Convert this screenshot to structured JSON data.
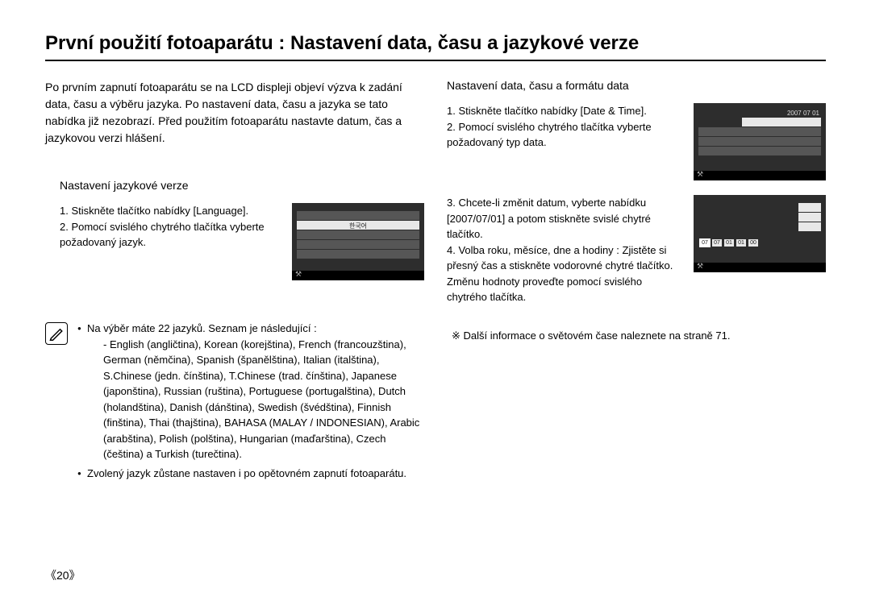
{
  "title": "První použití fotoaparátu : Nastavení data, času a jazykové verze",
  "intro": "Po prvním zapnutí fotoaparátu se na LCD displeji objeví výzva k zadání data, času a výběru jazyka. Po nastavení data, času a jazyka se tato nabídka již nezobrazí. Před použitím fotoaparátu nastavte datum, čas a jazykovou verzi hlášení.",
  "left": {
    "subhead": "Nastavení jazykové verze",
    "step1": "1. Stiskněte tlačítko nabídky [Language].",
    "step2": "2. Pomocí svislého chytrého tlačítka vyberte požadovaný jazyk.",
    "preview_label": "한국어",
    "note_intro": "Na výběr máte 22 jazyků. Seznam je následující :",
    "note_langs": "- English (angličtina), Korean (korejština), French (francouzština), German (němčina), Spanish (španělština), Italian (italština), S.Chinese (jedn. čínština), T.Chinese (trad. čínština), Japanese (japonština), Russian (ruština), Portuguese (portugalština), Dutch (holandština), Danish (dánština), Swedish (švédština), Finnish (finština), Thai (thajština), BAHASA (MALAY / INDONESIAN), Arabic (arabština), Polish (polština), Hungarian (maďarština), Czech (čeština) a Turkish (turečtina).",
    "note_persist": "Zvolený jazyk zůstane nastaven i po opětovném zapnutí fotoaparátu."
  },
  "right": {
    "subhead": "Nastavení data, času a formátu data",
    "step1": "1. Stiskněte tlačítko nabídky [Date & Time].",
    "step2": "2. Pomocí svislého chytrého tlačítka vyberte požadovaný typ data.",
    "preview1_label": "2007 07 01",
    "step3": "3. Chcete-li změnit datum, vyberte nabídku [2007/07/01] a potom stiskněte svislé chytré tlačítko.",
    "step4": "4. Volba roku, měsíce, dne a hodiny : Zjistěte si přesný čas a stiskněte vodorovné chytré tlačítko. Změnu hodnoty proveďte pomocí svislého chytrého tlačítka.",
    "preview2_year": "07",
    "preview2_month": "07",
    "preview2_day": "01",
    "preview2_hour": "01",
    "preview2_min": "00",
    "footnote": "※ Další informace o světovém čase naleznete na straně 71."
  },
  "pagenum": "《20》"
}
